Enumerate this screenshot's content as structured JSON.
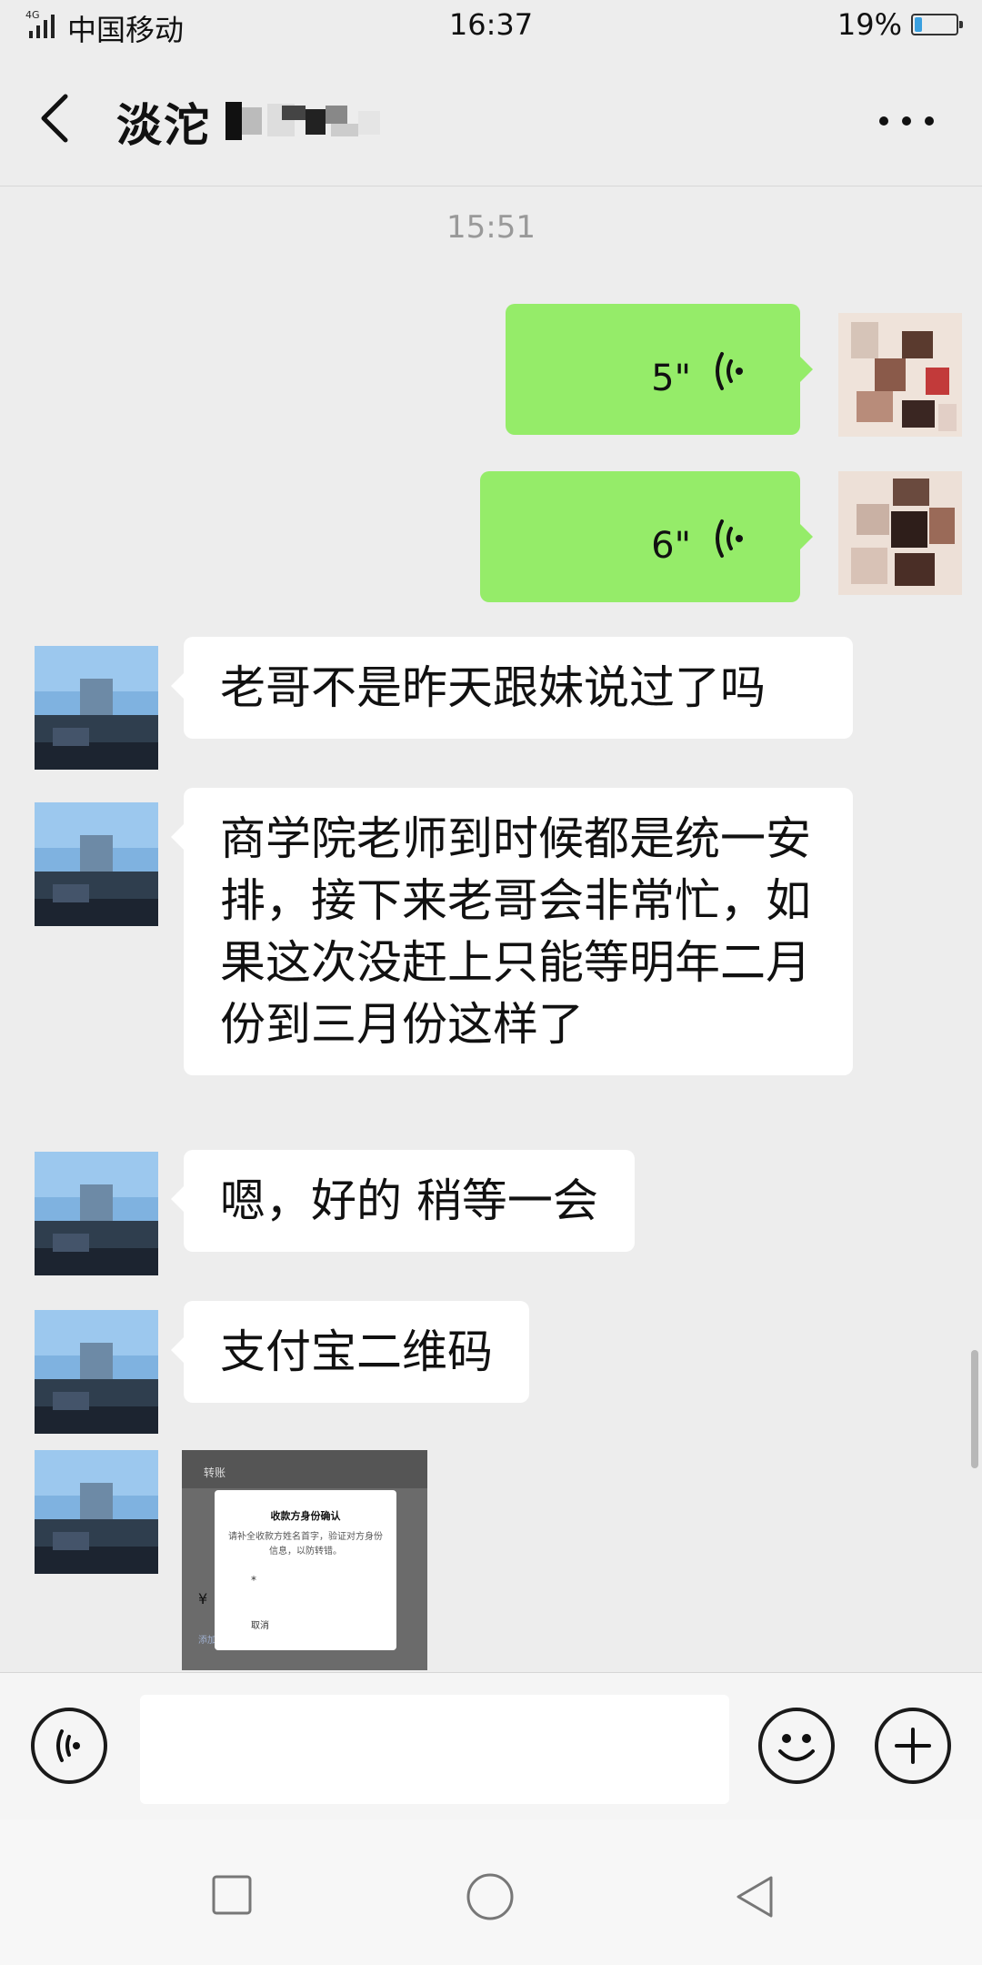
{
  "status_bar": {
    "network": "4G",
    "carrier": "中国移动",
    "time": "16:37",
    "battery": "19%",
    "battery_level": 0.19
  },
  "header": {
    "title": "淡沱",
    "back_icon": "back-chevron-icon",
    "more_icon": "more-dots-icon"
  },
  "chat": {
    "timestamp": "15:51",
    "voice_messages": [
      {
        "duration": "5\""
      },
      {
        "duration": "6\""
      }
    ],
    "text_messages": [
      {
        "text": "老哥不是昨天跟妹说过了吗"
      },
      {
        "lines": [
          "商学院老师到时候都是统一安",
          "排，接下来老哥会非常忙，如",
          "果这次没赶上只能等明年二月",
          "份到三月份这样了"
        ]
      },
      {
        "text": "嗯，好的 稍等一会"
      },
      {
        "text": "支付宝二维码"
      }
    ],
    "image_message": {
      "screen_title": "转账",
      "dialog_title": "收款方身份确认",
      "dialog_body": "请补全收款方姓名首字，验证对方身份信息，以防转错。",
      "input_text": "*",
      "cancel_label": "取消",
      "amount_symbol": "¥",
      "link_text": "添加转账说明"
    }
  },
  "input_bar": {
    "voice_icon": "voice-input-icon",
    "emoji_icon": "emoji-icon",
    "plus_icon": "plus-icon"
  },
  "nav_bar": {
    "icons": [
      "square-recent-icon",
      "circle-home-icon",
      "triangle-back-icon"
    ]
  },
  "colors": {
    "background": "#ededed",
    "sent_bubble": "#95ec69",
    "received_bubble": "#ffffff",
    "timestamp": "#999999"
  }
}
